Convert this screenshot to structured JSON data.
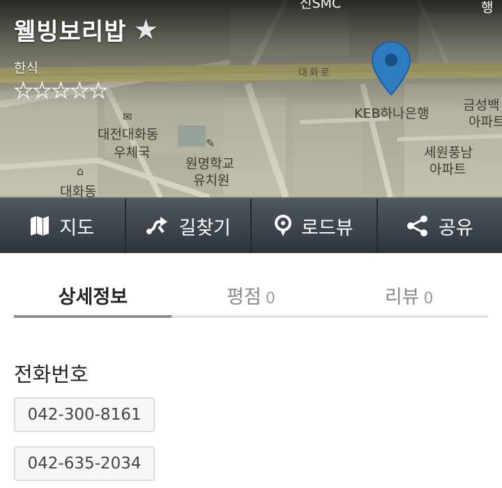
{
  "place": {
    "name": "웰빙보리밥",
    "category": "한식",
    "rating_stars": "☆☆☆☆☆"
  },
  "map": {
    "labels": {
      "road": "대화로",
      "bank": "KEB하나은행",
      "post_office_1": "대전대화동",
      "post_office_2": "우체국",
      "kindergarten_1": "원명학교",
      "kindergarten_2": "유치원",
      "apt_a_1": "금성백",
      "apt_a_2": "아파트",
      "apt_b_1": "세원풍남",
      "apt_b_2": "아파트",
      "district": "대화동",
      "top_cut_1": "신SMC",
      "top_cut_2": "행"
    }
  },
  "actions": {
    "map": "지도",
    "directions": "길찾기",
    "roadview": "로드뷰",
    "share": "공유"
  },
  "tabs": {
    "detail": "상세정보",
    "score": "평점",
    "score_count": "0",
    "review": "리뷰",
    "review_count": "0"
  },
  "contact": {
    "section_title": "전화번호",
    "phones": [
      "042-300-8161",
      "042-635-2034"
    ]
  },
  "colors": {
    "pin": "#2e7bc2",
    "action_bar": "#3a434a",
    "tab_indicator": "#8c8c8c"
  }
}
